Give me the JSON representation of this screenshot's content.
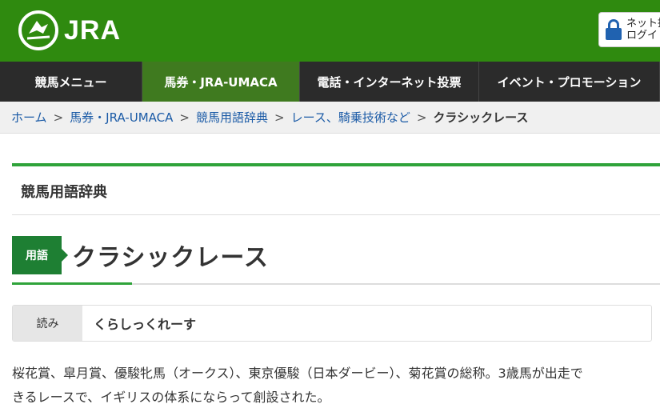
{
  "header": {
    "logo_text": "JRA",
    "login_line1": "ネット投",
    "login_line2": "ログイ",
    "colors": {
      "header_bg": "#2f8a0f",
      "lock": "#2062b0"
    }
  },
  "gnav": {
    "items": [
      {
        "label": "競馬メニュー"
      },
      {
        "label": "馬券・JRA-UMACA"
      },
      {
        "label": "電話・インターネット投票"
      },
      {
        "label": "イベント・プロモーション"
      }
    ]
  },
  "breadcrumb": {
    "links": [
      "ホーム",
      "馬券・JRA-UMACA",
      "競馬用語辞典",
      "レース、騎乗技術など"
    ],
    "separator": ">",
    "current": "クラシックレース"
  },
  "section": {
    "title": "競馬用語辞典"
  },
  "term": {
    "badge": "用語",
    "title": "クラシックレース",
    "reading_label": "読み",
    "reading_value": "くらしっくれーす",
    "description_line1": "桜花賞、皐月賞、優駿牝馬（オークス）、東京優駿（日本ダービー）、菊花賞の総称。3歳馬が出走で",
    "description_line2": "きるレースで、イギリスの体系にならって創設された。"
  },
  "colors": {
    "accent_green": "#2fa33a",
    "badge_green": "#1e7f33",
    "link_blue": "#1a5aa6"
  }
}
